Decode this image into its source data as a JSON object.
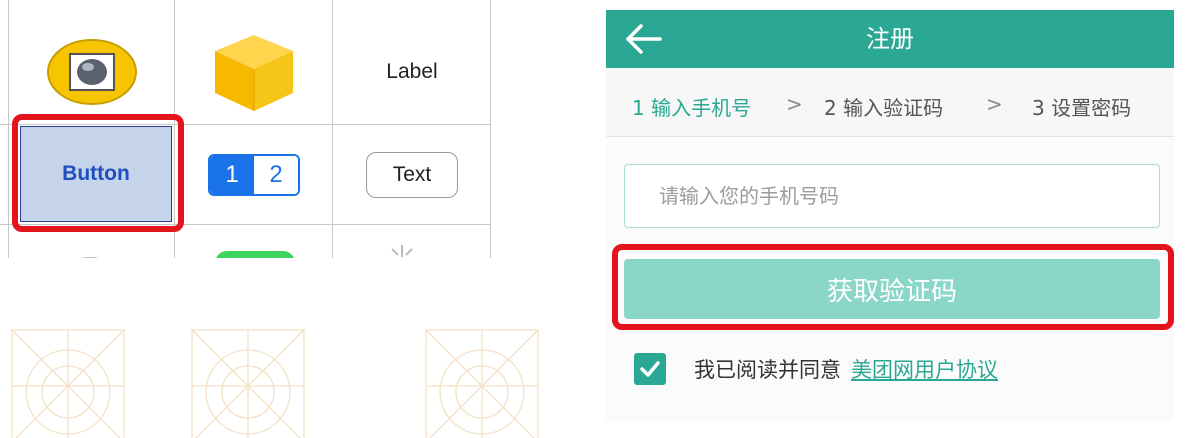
{
  "palette": {
    "label_cell": "Label",
    "button_cell": "Button",
    "segment": [
      "1",
      "2"
    ],
    "textfield_cell": "Text"
  },
  "signup": {
    "title": "注册",
    "back_icon": "arrow-left-icon",
    "steps": [
      {
        "label": "1 输入手机号",
        "active": true
      },
      {
        "label": "2 输入验证码",
        "active": false
      },
      {
        "label": "3 设置密码",
        "active": false
      }
    ],
    "step_separator": ">",
    "phone_placeholder": "请输入您的手机号码",
    "phone_value": "",
    "get_code_label": "获取验证码",
    "agreement_text": "我已阅读并同意",
    "agreement_link": "美团网用户协议",
    "agreement_checked": true
  },
  "colors": {
    "brand": "#2aa894",
    "button_disabled": "#8ad7c9",
    "highlight": "#e4141c"
  }
}
